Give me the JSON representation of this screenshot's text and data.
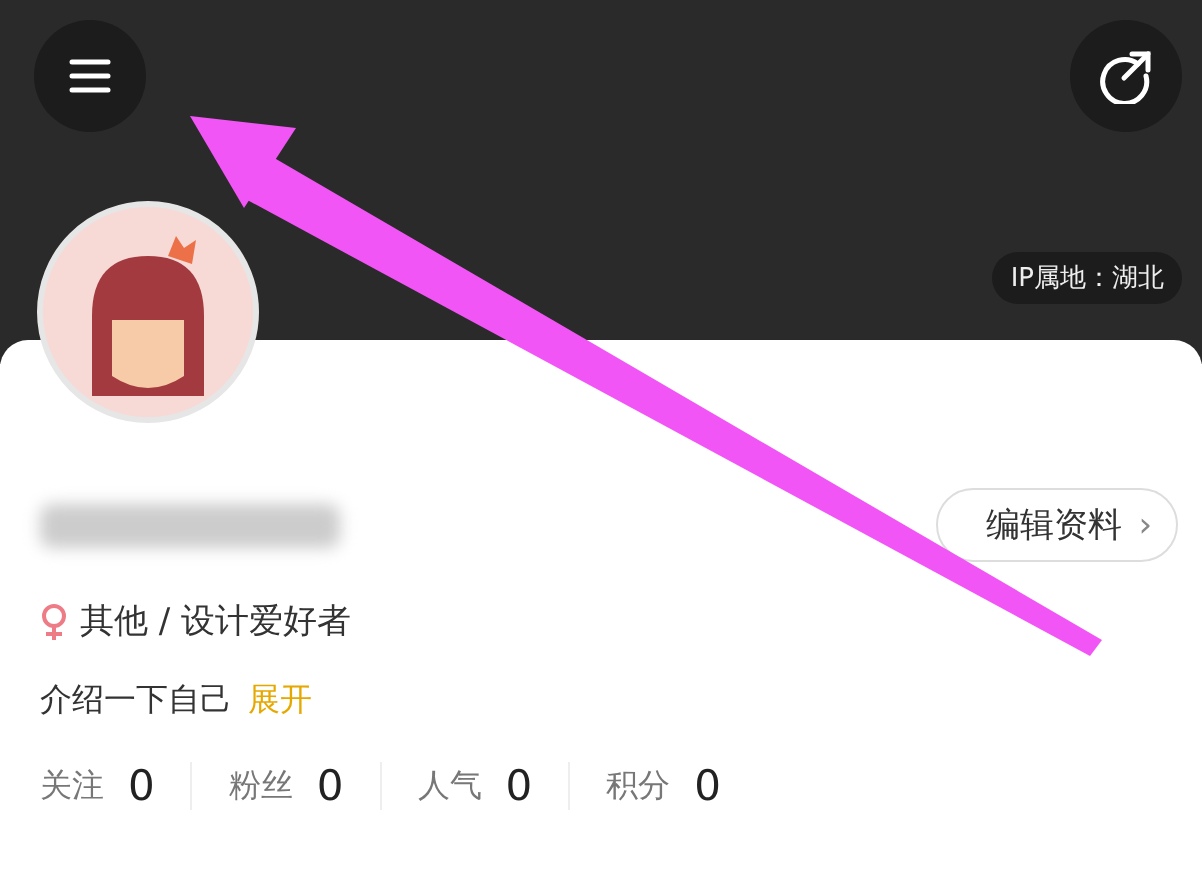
{
  "header": {
    "ip_location": "IP属地：湖北"
  },
  "profile": {
    "edit_button": "编辑资料",
    "edit_chevron": "›",
    "tags": "其他 / 设计爱好者",
    "intro": "介绍一下自己",
    "expand_link": "展开"
  },
  "stats": [
    {
      "label": "关注",
      "value": "0"
    },
    {
      "label": "粉丝",
      "value": "0"
    },
    {
      "label": "人气",
      "value": "0"
    },
    {
      "label": "积分",
      "value": "0"
    }
  ]
}
